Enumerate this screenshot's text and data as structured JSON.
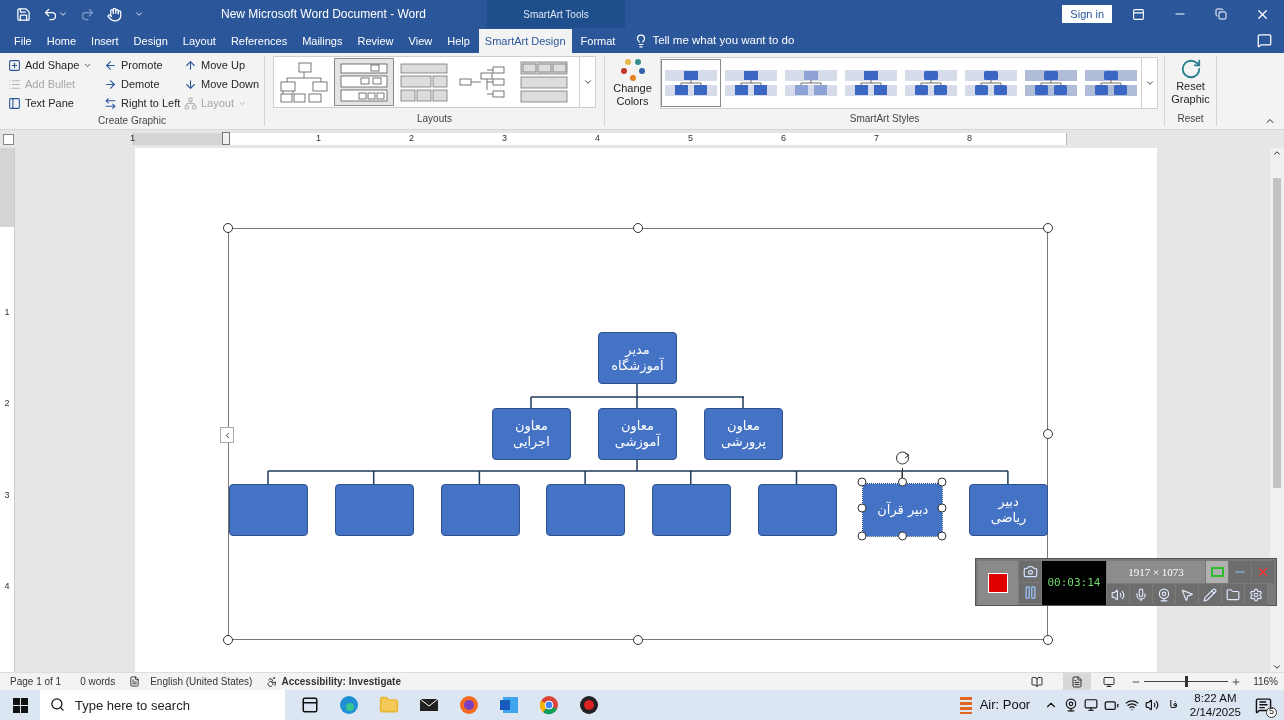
{
  "window": {
    "title": "New Microsoft Word Document  -  Word",
    "context_group": "SmartArt Tools",
    "sign_in": "Sign in"
  },
  "ribbon_tabs": [
    {
      "label": "File",
      "selected": false
    },
    {
      "label": "Home",
      "selected": false
    },
    {
      "label": "Insert",
      "selected": false
    },
    {
      "label": "Design",
      "selected": false
    },
    {
      "label": "Layout",
      "selected": false
    },
    {
      "label": "References",
      "selected": false
    },
    {
      "label": "Mailings",
      "selected": false
    },
    {
      "label": "Review",
      "selected": false
    },
    {
      "label": "View",
      "selected": false
    },
    {
      "label": "Help",
      "selected": false
    },
    {
      "label": "SmartArt Design",
      "selected": true
    },
    {
      "label": "Format",
      "selected": false
    }
  ],
  "tell_me": {
    "placeholder": "Tell me what you want to do"
  },
  "create_graphic": {
    "label": "Create Graphic",
    "commands": [
      {
        "kind": "add-shape",
        "label": "Add Shape",
        "disabled": false,
        "menu": true
      },
      {
        "kind": "add-bullet",
        "label": "Add Bullet",
        "disabled": true,
        "menu": false
      },
      {
        "kind": "text-pane",
        "label": "Text Pane",
        "disabled": false,
        "menu": false
      },
      {
        "kind": "promote",
        "label": "Promote",
        "disabled": false,
        "menu": false
      },
      {
        "kind": "demote",
        "label": "Demote",
        "disabled": false,
        "menu": false
      },
      {
        "kind": "right-to-left",
        "label": "Right to Left",
        "disabled": false,
        "menu": false
      },
      {
        "kind": "move-up",
        "label": "Move Up",
        "disabled": false,
        "menu": false
      },
      {
        "kind": "move-down",
        "label": "Move Down",
        "disabled": false,
        "menu": false
      },
      {
        "kind": "layout",
        "label": "Layout",
        "disabled": true,
        "menu": true
      }
    ]
  },
  "layouts": {
    "label": "Layouts",
    "items": [
      {
        "kind": "org",
        "selected": false
      },
      {
        "kind": "nested",
        "selected": true
      },
      {
        "kind": "blocks",
        "selected": false
      },
      {
        "kind": "horizontal",
        "selected": false
      },
      {
        "kind": "table",
        "selected": false
      }
    ]
  },
  "change_colors": {
    "label": "Change Colors"
  },
  "smartart_styles": {
    "label": "SmartArt Styles",
    "items": [
      {
        "selected": true
      },
      {
        "selected": false
      },
      {
        "selected": false
      },
      {
        "selected": false
      },
      {
        "selected": false
      },
      {
        "selected": false
      },
      {
        "selected": false
      },
      {
        "selected": false
      }
    ]
  },
  "reset": {
    "button": "Reset Graphic",
    "label": "Reset"
  },
  "ruler": {
    "horizontal": [
      "1",
      "1",
      "2",
      "3",
      "4",
      "5",
      "6",
      "7",
      "8"
    ],
    "vertical": [
      "1",
      "2",
      "3",
      "4"
    ]
  },
  "org_chart": {
    "text": "مدیر\nآموزشگاه",
    "selected": false,
    "children": [
      {
        "text": "معاون\nپرورشی",
        "selected": false
      },
      {
        "text": "معاون\nآموزشی",
        "selected": false,
        "children": [
          {
            "text": "دبیر\nریاضی",
            "selected": false
          },
          {
            "text": "دبیر قرآن",
            "selected": true
          },
          {
            "selected": false
          },
          {
            "selected": false
          },
          {
            "selected": false
          },
          {
            "selected": false
          },
          {
            "selected": false
          },
          {
            "selected": false
          }
        ]
      },
      {
        "text": "معاون\nاجرایی",
        "selected": false
      }
    ]
  },
  "recorder": {
    "timer": "00:03:14",
    "resolution": "1917 × 1073"
  },
  "status_bar": {
    "items": [
      "Page 1 of 1",
      "0 words",
      "English (United States)",
      "Accessibility: Investigate"
    ],
    "zoom": {
      "label": "116%",
      "level": 0.5
    }
  },
  "taskbar": {
    "search": {
      "placeholder": "Type here to search"
    },
    "weather": "Air: Poor",
    "language": "فا",
    "time": "8:22 AM",
    "date": "2/14/2025",
    "notifications": "5"
  }
}
